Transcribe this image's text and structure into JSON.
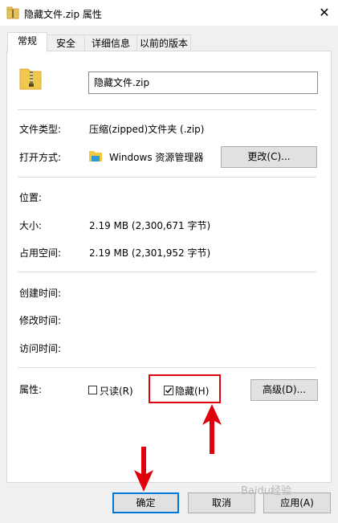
{
  "window": {
    "title": "隐藏文件.zip 属性",
    "close_glyph": "✕"
  },
  "tabs": [
    {
      "label": "常规"
    },
    {
      "label": "安全"
    },
    {
      "label": "详细信息"
    },
    {
      "label": "以前的版本"
    }
  ],
  "file": {
    "name": "隐藏文件.zip"
  },
  "props": {
    "type_label": "文件类型:",
    "type_value": "压缩(zipped)文件夹 (.zip)",
    "open_label": "打开方式:",
    "open_value": "Windows 资源管理器",
    "change_button": "更改(C)...",
    "location_label": "位置:",
    "size_label": "大小:",
    "size_value": "2.19 MB (2,300,671 字节)",
    "disk_label": "占用空间:",
    "disk_value": "2.19 MB (2,301,952 字节)",
    "created_label": "创建时间:",
    "modified_label": "修改时间:",
    "accessed_label": "访问时间:",
    "attr_label": "属性:",
    "readonly_label": "只读(R)",
    "hidden_label": "隐藏(H)",
    "advanced_button": "高级(D)...",
    "readonly_checked": false,
    "hidden_checked": true
  },
  "buttons": {
    "ok": "确定",
    "cancel": "取消",
    "apply": "应用(A)"
  },
  "annotations": {
    "highlight_color": "#e0000b",
    "arrow_color": "#e0000b"
  },
  "watermark": {
    "text": "Baidu经验"
  }
}
